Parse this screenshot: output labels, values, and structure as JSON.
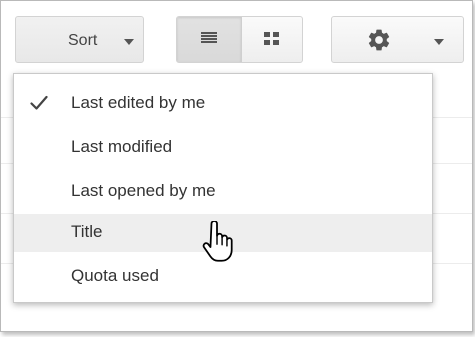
{
  "toolbar": {
    "sort_label": "Sort"
  },
  "menu": {
    "items": [
      {
        "label": "Last edited by me",
        "checked": true,
        "highlighted": false
      },
      {
        "label": "Last modified",
        "checked": false,
        "highlighted": false
      },
      {
        "label": "Last opened by me",
        "checked": false,
        "highlighted": false
      },
      {
        "label": "Title",
        "checked": false,
        "highlighted": true
      },
      {
        "label": "Quota used",
        "checked": false,
        "highlighted": false
      }
    ]
  },
  "icons": {
    "check": "check-icon",
    "list_view": "list-view-icon",
    "grid_view": "grid-view-icon",
    "settings": "gear-icon",
    "caret": "chevron-down-icon",
    "cursor": "hand-pointer-icon"
  },
  "colors": {
    "highlight": "#eeeeee",
    "text": "#333333",
    "icon": "#555555",
    "border": "#c9c9c9"
  }
}
